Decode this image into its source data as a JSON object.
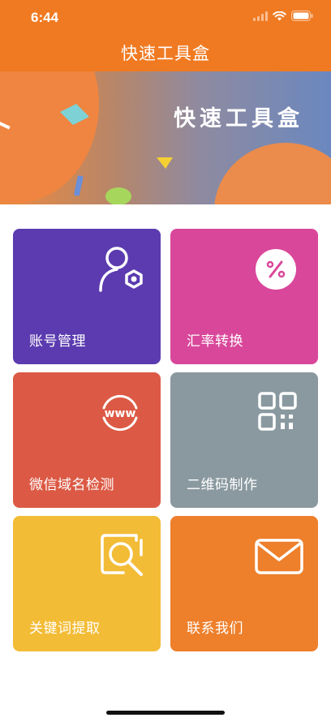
{
  "status": {
    "time": "6:44"
  },
  "nav": {
    "title": "快速工具盒"
  },
  "banner": {
    "title": "快速工具盒"
  },
  "tiles": [
    {
      "label": "账号管理",
      "icon": "user-settings-icon",
      "color": "#5B3BAF"
    },
    {
      "label": "汇率转换",
      "icon": "percent-icon",
      "color": "#D9479A"
    },
    {
      "label": "微信域名检测",
      "icon": "www-globe-icon",
      "color": "#DC5A45"
    },
    {
      "label": "二维码制作",
      "icon": "qr-code-icon",
      "color": "#8A99A0"
    },
    {
      "label": "关键词提取",
      "icon": "search-frame-icon",
      "color": "#F3BC36"
    },
    {
      "label": "联系我们",
      "icon": "mail-icon",
      "color": "#EE7F2B"
    }
  ]
}
